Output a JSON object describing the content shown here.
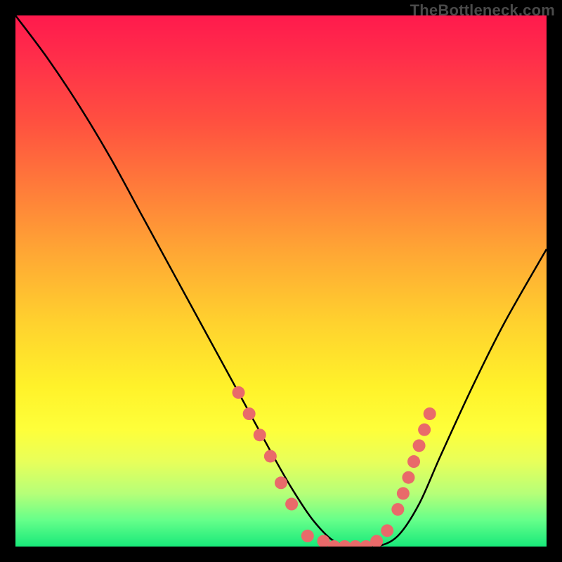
{
  "watermark": "TheBottleneck.com",
  "colors": {
    "curve_stroke": "#000000",
    "dot_fill": "#e96a6a",
    "background": "#000000"
  },
  "chart_data": {
    "type": "line",
    "title": "",
    "xlabel": "",
    "ylabel": "",
    "xlim": [
      0,
      100
    ],
    "ylim": [
      0,
      100
    ],
    "grid": false,
    "legend": false,
    "series": [
      {
        "name": "bottleneck-curve",
        "x": [
          0,
          6,
          12,
          18,
          24,
          30,
          36,
          42,
          48,
          52,
          56,
          60,
          64,
          68,
          72,
          76,
          80,
          86,
          92,
          100
        ],
        "values": [
          100,
          92,
          83,
          73,
          62,
          51,
          40,
          29,
          18,
          11,
          5,
          1,
          0,
          0,
          2,
          8,
          17,
          30,
          42,
          56
        ]
      }
    ],
    "markers": [
      {
        "name": "left-cluster",
        "points": [
          {
            "x": 42,
            "y": 29
          },
          {
            "x": 44,
            "y": 25
          },
          {
            "x": 46,
            "y": 21
          },
          {
            "x": 48,
            "y": 17
          },
          {
            "x": 50,
            "y": 12
          },
          {
            "x": 52,
            "y": 8
          }
        ]
      },
      {
        "name": "bottom-cluster",
        "points": [
          {
            "x": 55,
            "y": 2
          },
          {
            "x": 58,
            "y": 1
          },
          {
            "x": 60,
            "y": 0
          },
          {
            "x": 62,
            "y": 0
          },
          {
            "x": 64,
            "y": 0
          },
          {
            "x": 66,
            "y": 0
          },
          {
            "x": 68,
            "y": 1
          },
          {
            "x": 70,
            "y": 3
          }
        ]
      },
      {
        "name": "right-cluster",
        "points": [
          {
            "x": 72,
            "y": 7
          },
          {
            "x": 73,
            "y": 10
          },
          {
            "x": 74,
            "y": 13
          },
          {
            "x": 75,
            "y": 16
          },
          {
            "x": 76,
            "y": 19
          },
          {
            "x": 77,
            "y": 22
          },
          {
            "x": 78,
            "y": 25
          }
        ]
      }
    ]
  }
}
